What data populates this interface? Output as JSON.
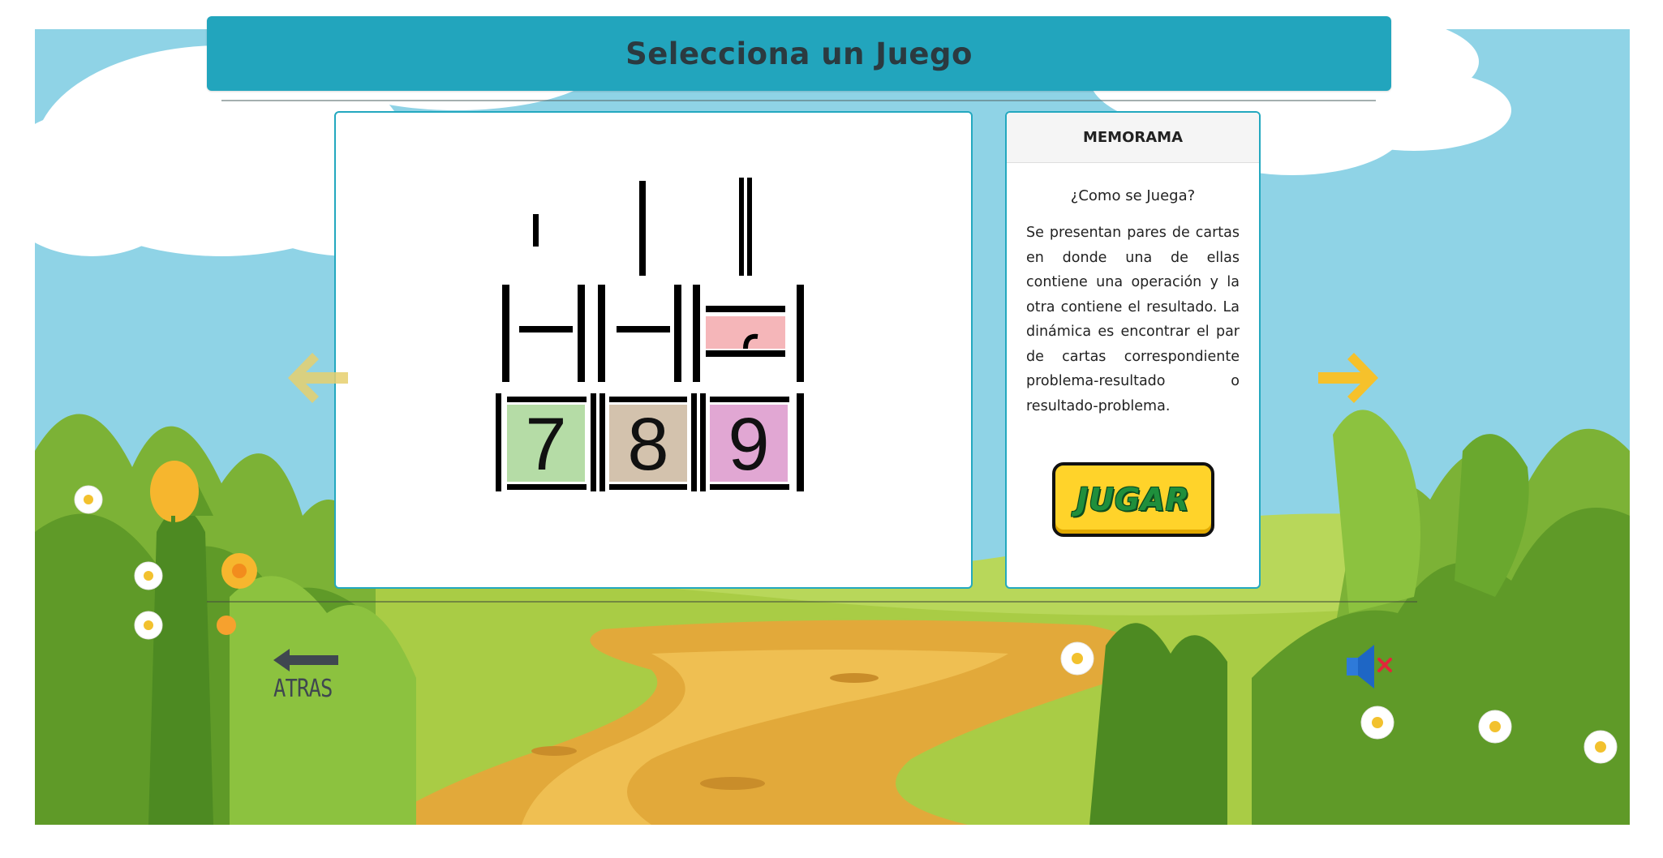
{
  "header": {
    "title": "Selecciona un Juego"
  },
  "game": {
    "name": "MEMORAMA",
    "how_to_play_heading": "¿Como se Juega?",
    "description": "Se presentan pares de cartas en donde una de ellas contiene una operación y la otra contiene el resultado. La dinámica es encontrar el par de cartas correspondiente problema-resultado o resultado-problema.",
    "play_button_label": "JUGAR"
  },
  "preview": {
    "digits": [
      "7",
      "8",
      "9"
    ],
    "digit_colors": [
      "#b5dca6",
      "#d3c2ad",
      "#e1a7d3"
    ],
    "partial_tile_color": "#f5b6b9"
  },
  "navigation": {
    "back_label": "ATRAS",
    "prev_arrow_icon": "arrow-left-icon",
    "next_arrow_icon": "arrow-right-icon",
    "arrow_color_active": "#f6c12b",
    "arrow_color_disabled": "#e6cf6d"
  },
  "audio": {
    "icon": "speaker-muted-icon",
    "muted": true
  }
}
